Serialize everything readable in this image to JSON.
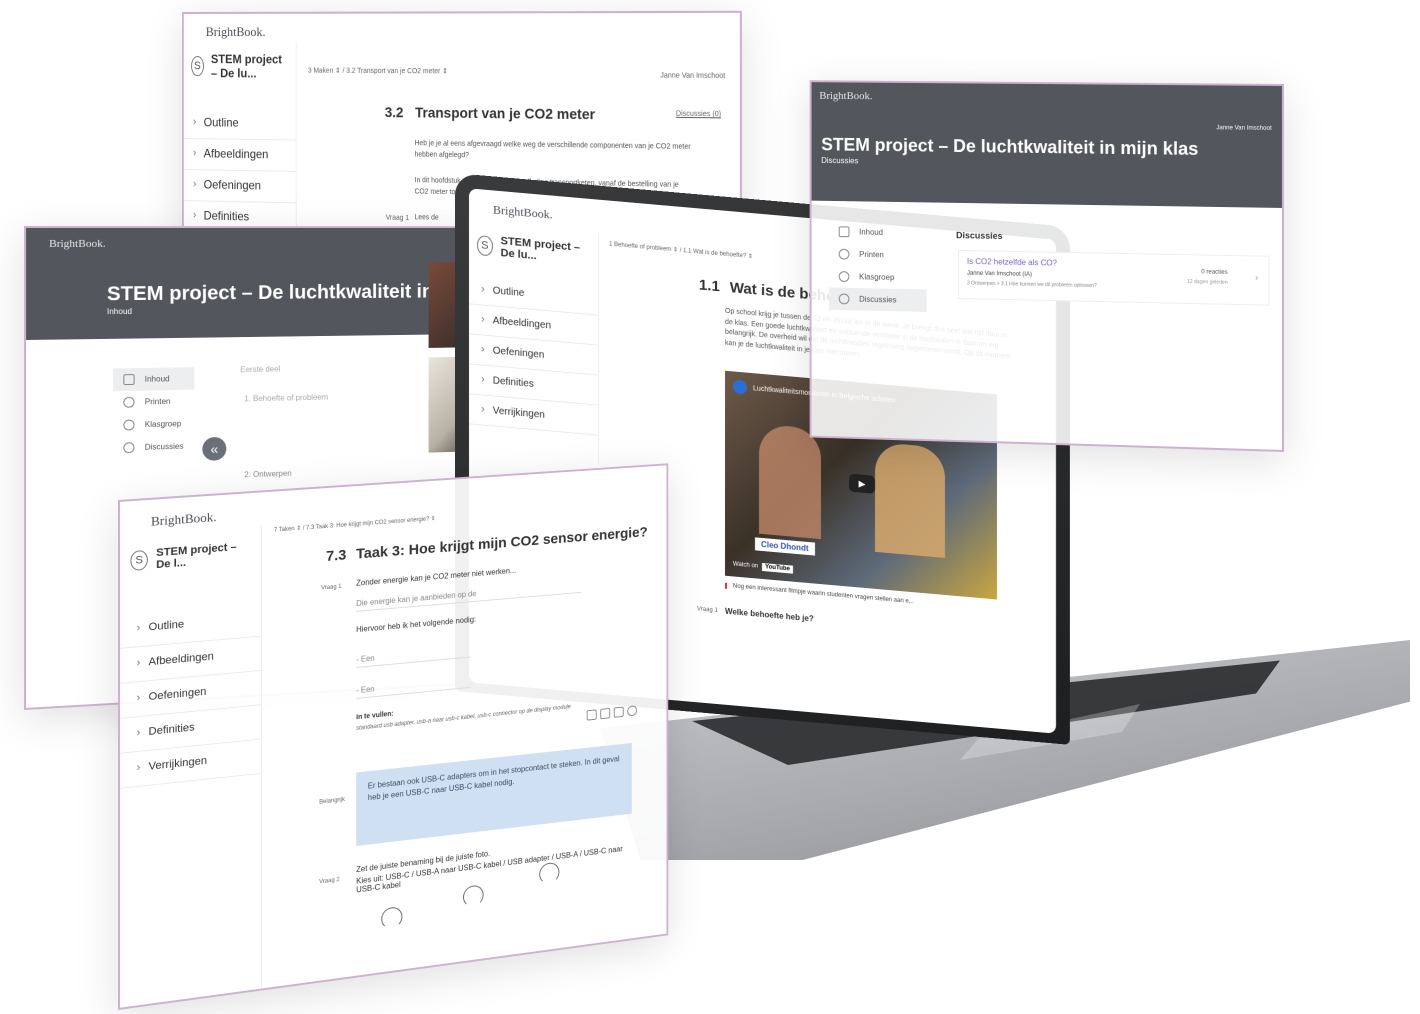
{
  "brand": "BrightBook.",
  "course_short": "STEM project – De lu...",
  "course_short2": "STEM project – De l...",
  "course_full": "STEM project – De luchtkwaliteit in mijn klas",
  "user": "Janne Van Imschoot",
  "outline": [
    "Outline",
    "Afbeeldingen",
    "Oefeningen",
    "Definities",
    "Verrijkingen"
  ],
  "panel_back": {
    "crumb": "3 Maken ⇕  /  3.2 Transport van je CO2 meter ⇕",
    "number": "3.2",
    "title": "Transport van je CO2 meter",
    "discuss": "Discussies (0)",
    "p1": "Heb je je al eens afgevraagd welke weg de verschillende componenten van je CO2 meter hebben afgelegd?",
    "p2": "In dit hoofdstuk staan we stil bij de volledige transportketen, vanaf de bestelling van je CO2 meter tot bij jou in de klas.",
    "vraag": "Vraag 1",
    "vraag_text": "Lees de"
  },
  "panel_left": {
    "subtitle": "Inhoud",
    "nav": [
      "Inhoud",
      "Printen",
      "Klasgroep",
      "Discussies"
    ],
    "section_label": "Eerste deel",
    "item1": "1. Behoefte of probleem",
    "item2": "2. Ontwerpen"
  },
  "laptop": {
    "crumb": "1 Behoefte of probleem ⇕  /  1.1 Wat is de behoefte? ⇕",
    "number": "1.1",
    "title": "Wat is de behoefte?",
    "p1": "Op school krijg je tussen de 32 en 36 uur les in de week. Je brengt dus heel wat tijd door in de klas. Een goede luchtkwaliteit en voldoende ventilatie in de klaslokalen is daarom erg belangrijk. De overheid wil dat de luchtkwaliteit regelmatig nagemeten wordt. Op dit moment kan je de luchtkwaliteit in je klas niet meten.",
    "video_title": "Luchtkwaliteitsmonitoren in Belgische scholen",
    "video_name": "Cleo Dhondt",
    "watch_on": "Watch on",
    "youtube": "YouTube",
    "video_caption": "Nog een interessant filmpje waarin studenten vragen stellen aan e...",
    "vraag": "Vraag 1",
    "vraag_text": "Welke behoefte heb je?"
  },
  "panel_right": {
    "subtitle": "Discussies",
    "nav": [
      "Inhoud",
      "Printen",
      "Klasgroep",
      "Discussies"
    ],
    "section": "Discussies",
    "thread_title": "Is CO2 hetzelfde als CO?",
    "thread_author": "Janne Van Imschoot (IA)",
    "thread_meta": "3 Ontwerpen > 3.1 Hoe kunnen we dit probleem oplossen?",
    "replies": "0 reacties",
    "age": "12 dagen geleden"
  },
  "panel_front": {
    "crumb": "7 Taken ⇕  /  7.3 Taak 3: Hoe krijgt mijn CO2 sensor energie? ⇕",
    "number": "7.3",
    "title": "Taak 3: Hoe krijgt mijn CO2 sensor energie?",
    "vraag1": "Vraag 1",
    "intro": "Zonder energie kan je CO2 meter niet werken...",
    "intro2": "Die energie kan je aanbieden op de",
    "need": "Hiervoor heb ik het volgende nodig:",
    "een": "- Een",
    "fill_label": "In te vullen:",
    "fill_options": "standaard usb adapter, usb-a naar usb-c kabel, usb-c connector op de display module",
    "belangrijk": "Belangrijk",
    "blue": "Er bestaan ook USB-C adapters om in het stopcontact te steken. In dit geval heb je een USB-C naar USB-C kabel nodig.",
    "vraag2": "Vraag 2",
    "q2a": "Zet de juiste benaming bij de juiste foto.",
    "q2b": "Kies uit: USB-C / USB-A naar USB-C kabel / USB adapter / USB-A / USB-C naar USB-C kabel"
  },
  "colors": {
    "header_dark": "#53565c",
    "accent_purple": "#7b5fc4",
    "panel_border": "#cdb2cf",
    "info_blue": "#cfe0f2"
  },
  "icons": [
    "chevron-right-icon",
    "course-logo-icon",
    "book-icon",
    "printer-icon",
    "group-icon",
    "chat-icon",
    "play-icon",
    "collapse-icon"
  ]
}
